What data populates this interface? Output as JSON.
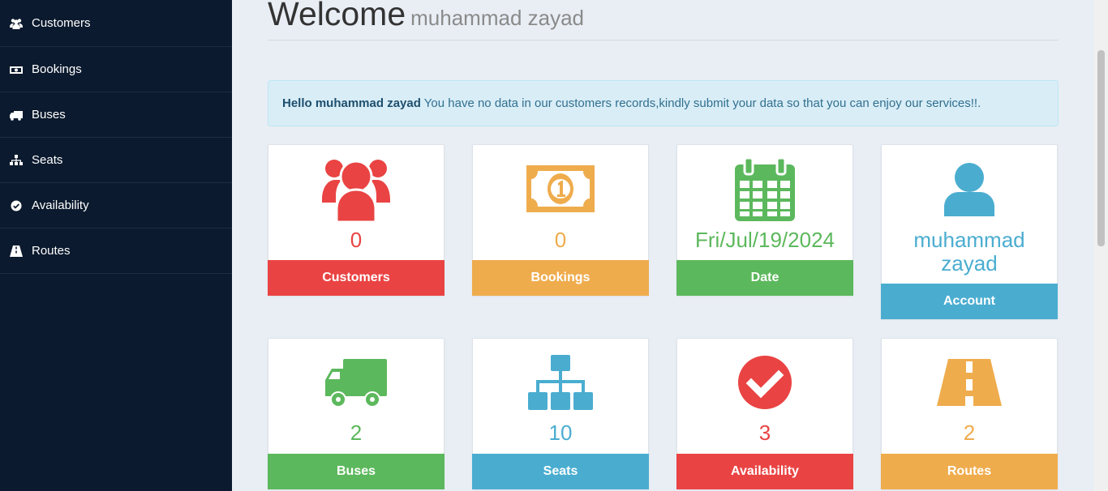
{
  "sidebar": {
    "items": [
      {
        "label": "Customers",
        "icon": "users-icon"
      },
      {
        "label": "Bookings",
        "icon": "money-icon"
      },
      {
        "label": "Buses",
        "icon": "truck-icon"
      },
      {
        "label": "Seats",
        "icon": "sitemap-icon"
      },
      {
        "label": "Availability",
        "icon": "check-circle-icon"
      },
      {
        "label": "Routes",
        "icon": "road-icon"
      }
    ]
  },
  "header": {
    "title": "Welcome",
    "username": "muhammad zayad"
  },
  "alert": {
    "name": "Hello muhammad zayad",
    "message": " You have no data in our customers records,kindly submit your data so that you can enjoy our services!!."
  },
  "cards": {
    "customers": {
      "value": "0",
      "label": "Customers",
      "color": "#ea4343",
      "icon": "users-icon"
    },
    "bookings": {
      "value": "0",
      "label": "Bookings",
      "color": "#efac4d",
      "icon": "money-icon"
    },
    "date": {
      "value": "Fri/Jul/19/2024",
      "label": "Date",
      "color": "#5cb85c",
      "icon": "calendar-icon"
    },
    "account": {
      "value": "muhammad zayad",
      "label": "Account",
      "color": "#4aadd0",
      "icon": "user-icon"
    },
    "buses": {
      "value": "2",
      "label": "Buses",
      "color": "#5cb85c",
      "icon": "truck-icon"
    },
    "seats": {
      "value": "10",
      "label": "Seats",
      "color": "#4aadd0",
      "icon": "sitemap-icon"
    },
    "availability": {
      "value": "3",
      "label": "Availability",
      "color": "#ea4343",
      "icon": "check-circle-icon"
    },
    "routes": {
      "value": "2",
      "label": "Routes",
      "color": "#efac4d",
      "icon": "road-icon"
    }
  }
}
